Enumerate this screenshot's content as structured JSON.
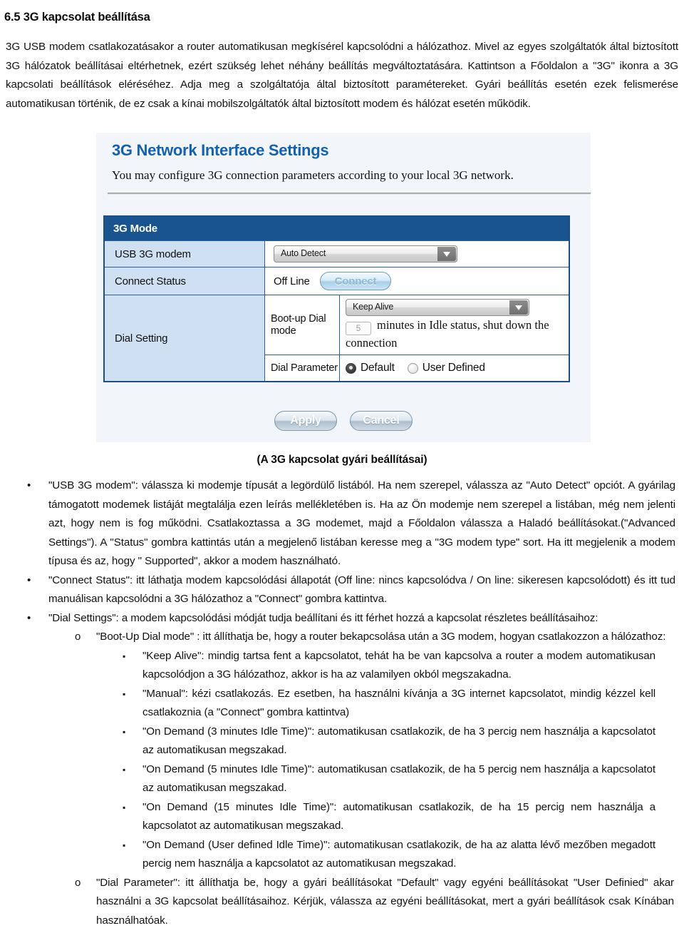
{
  "document": {
    "heading": "6.5 3G kapcsolat beállítása",
    "intro": "3G USB modem csatlakozatásakor a router automatikusan megkísérel kapcsolódni a hálózathoz. Mivel az egyes szolgáltatók által biztosított 3G hálózatok beállításai eltérhetnek, ezért szükség lehet néhány beállítás megváltoztatására. Kattintson a Főoldalon a \"3G\" ikonra a 3G kapcsolati beállítások eléréséhez. Adja meg a szolgáltatója által biztosított paramétereket. Gyári beállítás esetén ezek felismerése automatikusan történik, de ez csak a kínai mobilszolgáltatók által biztosított modem és hálózat esetén működik.",
    "figure_caption": "(A 3G kapcsolat gyári beállításai)"
  },
  "screenshot": {
    "title": "3G Network Interface Settings",
    "description": "You may configure 3G connection parameters according to your local 3G network.",
    "table": {
      "header": "3G Mode",
      "usb_modem_label": "USB 3G modem",
      "usb_modem_value": "Auto Detect",
      "connect_status_label": "Connect Status",
      "connect_status_value": "Off Line",
      "connect_button": "Connect",
      "dial_setting_label": "Dial Setting",
      "bootup_label": "Boot-up Dial mode",
      "bootup_value": "Keep Alive",
      "idle_minutes": "5",
      "idle_text": "minutes in Idle status, shut down the connection",
      "dial_parameter_label": "Dial Parameter",
      "radio_default": "Default",
      "radio_user_defined": "User Defined"
    },
    "buttons": {
      "apply": "Apply",
      "cancel": "Cancel"
    },
    "colors": {
      "title_blue": "#1461b0",
      "header_blue": "#1a5490",
      "label_blue": "#cfe0f2",
      "panel_bg": "#f2f6fb"
    }
  },
  "notes": [
    {
      "level": 1,
      "marker": "•",
      "text": "\"USB 3G modem\": válassza ki modemje típusát a legördülő listából. Ha nem szerepel, válassza az \"Auto Detect\" opciót. A gyárilag támogatott modemek listáját megtalálja ezen leírás mellékletében is. Ha az Ön modemje nem szerepel a listában, még nem jelenti azt, hogy nem is fog működni. Csatlakoztassa a 3G modemet, majd a Főoldalon válassza a Haladó beállításokat.(\"Advanced Settings\"). A \"Status\" gombra kattintás után a megjelenő listában keresse meg a \"3G modem type\" sort. Ha itt megjelenik a modem típusa és az, hogy \" Supported\", akkor a modem használható."
    },
    {
      "level": 1,
      "marker": "•",
      "text": "\"Connect Status\": itt láthatja modem kapcsolódási állapotát (Off line: nincs kapcsolódva / On line: sikeresen kapcsolódott) és itt tud manuálisan kapcsolódni a 3G hálózathoz a \"Connect\" gombra kattintva."
    },
    {
      "level": 1,
      "marker": "•",
      "text": "\"Dial Settings\": a modem kapcsolódási módját tudja beállítani és itt férhet hozzá a kapcsolat részletes beállításaihoz:"
    },
    {
      "level": 2,
      "marker": "o",
      "text": "\"Boot-Up Dial mode\" : itt állíthatja be, hogy a router bekapcsolása után a 3G modem, hogyan csatlakozzon a hálózathoz:"
    },
    {
      "level": 3,
      "marker": "▪",
      "text": "\"Keep Alive\": mindig tartsa fent a kapcsolatot, tehát ha be van kapcsolva a router a modem automatikusan kapcsolódjon a 3G hálózathoz, akkor is ha az valamilyen okból megszakadna."
    },
    {
      "level": 3,
      "marker": "▪",
      "text": "\"Manual\": kézi csatlakozás. Ez esetben, ha használni kívánja a 3G internet kapcsolatot, mindig kézzel kell csatlakoznia (a \"Connect\" gombra kattintva)"
    },
    {
      "level": 3,
      "marker": "▪",
      "text": "\"On Demand (3 minutes Idle Time)\": automatikusan csatlakozik, de ha 3 percig nem használja a kapcsolatot az automatikusan megszakad."
    },
    {
      "level": 3,
      "marker": "▪",
      "text": "\"On Demand (5 minutes Idle Time)\": automatikusan csatlakozik, de ha 5 percig nem használja a kapcsolatot az automatikusan megszakad."
    },
    {
      "level": 3,
      "marker": "▪",
      "text": "\"On Demand (15 minutes Idle Time)\": automatikusan csatlakozik, de ha 15 percig nem használja a kapcsolatot az automatikusan megszakad."
    },
    {
      "level": 3,
      "marker": "▪",
      "text": "\"On Demand (User defined Idle Time)\": automatikusan csatlakozik, de ha az alatta lévő mezőben megadott percig nem használja a kapcsolatot az automatikusan megszakad."
    },
    {
      "level": 2,
      "marker": "o",
      "text": "\"Dial Parameter\": itt állíthatja be, hogy a gyári beállításokat \"Default\" vagy egyéni beállításokat \"User Definied\" akar használni a 3G kapcsolat beállításaihoz. Kérjük, válassza az egyéni beállításokat, mert a gyári beállítások csak Kínában használhatóak."
    }
  ]
}
